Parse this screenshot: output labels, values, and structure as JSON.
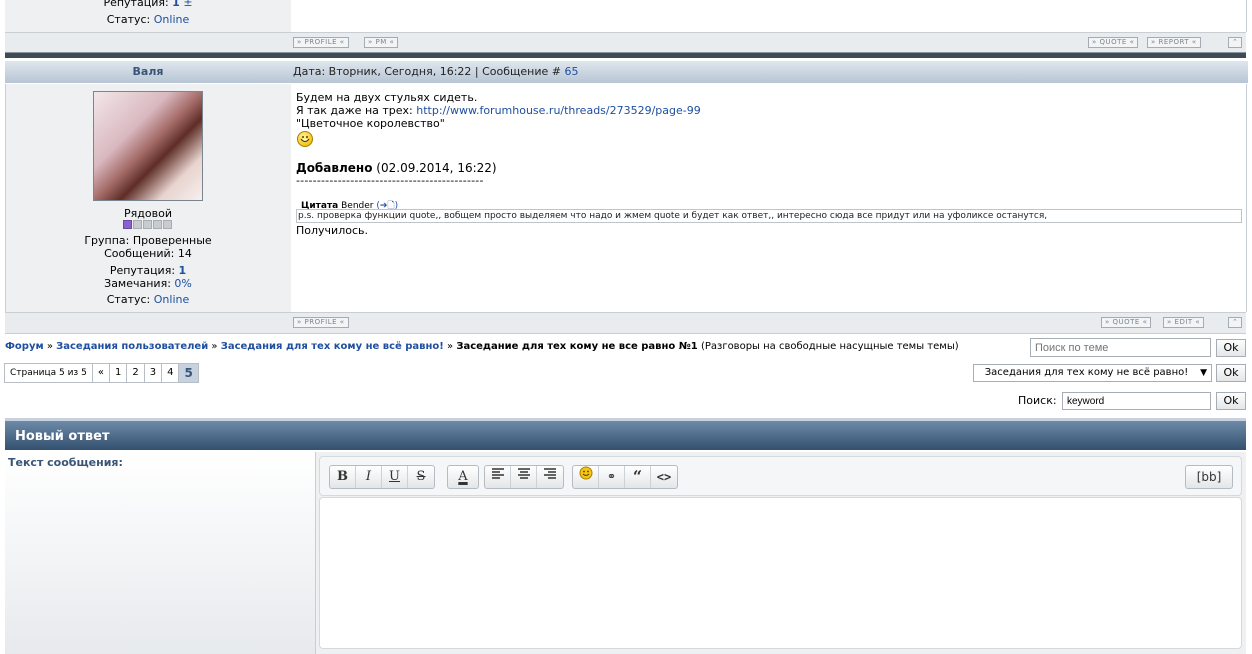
{
  "prev_post": {
    "reputation_label": "Репутация:",
    "reputation_value": "1",
    "reputation_sign": "±",
    "status_label": "Статус:",
    "status_value": "Online",
    "buttons": {
      "profile": "PROFILE",
      "pm": "PM",
      "quote": "QUOTE",
      "report": "REPORT"
    }
  },
  "post": {
    "author": "Валя",
    "header_text": "Дата: Вторник, Сегодня, 16:22 | Сообщение #",
    "post_number": "65",
    "rank": "Рядовой",
    "rank_level": 1,
    "rank_max": 5,
    "group": "Группа: Проверенные",
    "messages": "Сообщений: 14",
    "reputation_label": "Репутация:",
    "reputation_value": "1",
    "warnings_label": "Замечания:",
    "warnings_value": "0%",
    "status_label": "Статус:",
    "status_value": "Online",
    "body": {
      "line1": "Будем на двух стульях сидеть.",
      "line2_prefix": "Я так даже на трех:",
      "line2_link": "http://www.forumhouse.ru/threads/273529/page-99",
      "line3": "\"Цветочное королевство\"",
      "added_label": "Добавлено",
      "added_date": "(02.09.2014, 16:22)",
      "divider": "---------------------------------------------",
      "quote_label": "Цитата",
      "quote_author": "Bender",
      "quote_text": "p.s. проверка функции quote,, вобщем просто выделяем что надо и жмем quote и будет как ответ,, интересно сюда все придут или на уфоликсе останутся,",
      "closing": "Получилось."
    },
    "buttons": {
      "profile": "PROFILE",
      "quote": "QUOTE",
      "edit": "EDIT"
    }
  },
  "breadcrumb": {
    "forum": "Форум",
    "sep": "»",
    "section1": "Заседания пользователей",
    "section2": "Заседания для тех кому не всё равно!",
    "current": "Заседание для тех кому не все равно №1",
    "description": "(Разговоры на свободные насущные темы темы)"
  },
  "topic_search": {
    "placeholder": "Поиск по теме",
    "ok": "Ok"
  },
  "jump": {
    "selected": "Заседания для тех кому не всё равно!",
    "ok": "Ok"
  },
  "search": {
    "label": "Поиск:",
    "value": "keyword",
    "ok": "Ok"
  },
  "pager": {
    "label": "Страница 5 из 5",
    "prev": "«",
    "pages": [
      "1",
      "2",
      "3",
      "4"
    ],
    "current": "5"
  },
  "reply": {
    "title": "Новый ответ",
    "message_label": "Текст сообщения:",
    "bb": "[bb]"
  },
  "colors": {
    "link": "#1f4fa0",
    "header_dark": "#34506f",
    "rank_on": "#8a62c9"
  }
}
